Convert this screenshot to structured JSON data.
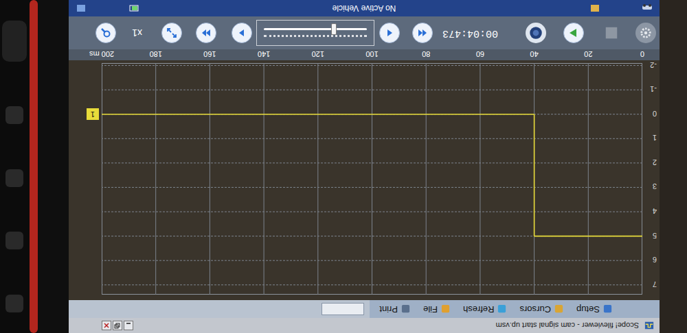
{
  "window": {
    "title": "Scope! fileviewer - cam signal start up.vsm"
  },
  "menu": [
    {
      "label": "Setup"
    },
    {
      "label": "Cursors"
    },
    {
      "label": "Refresh"
    },
    {
      "label": "File"
    },
    {
      "label": "Print"
    }
  ],
  "chart": {
    "y_ticks": [
      "7",
      "6",
      "5",
      "4",
      "3",
      "2",
      "1",
      "0",
      "-1",
      "-2"
    ],
    "x_ticks": [
      "0",
      "20",
      "40",
      "60",
      "80",
      "100",
      "120",
      "140",
      "160",
      "180",
      "200 ms"
    ],
    "series": [
      {
        "label": "1",
        "times": [
          0,
          40,
          40,
          200
        ],
        "values": [
          5,
          5,
          0,
          0
        ]
      }
    ]
  },
  "playback": {
    "time": "00:04:473",
    "zoom": "x1",
    "level": 0.32
  },
  "status_bar": {
    "text": "No Active Vehicle"
  }
}
